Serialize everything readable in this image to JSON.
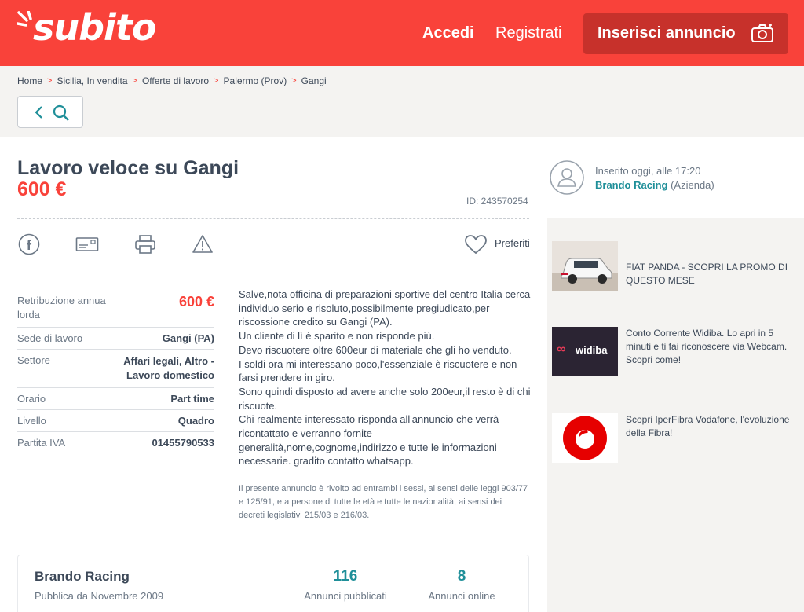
{
  "header": {
    "logo_text": "subito",
    "login": "Accedi",
    "register": "Registrati",
    "post_ad": "Inserisci annuncio",
    "brand_color": "#f9423a"
  },
  "breadcrumb": [
    "Home",
    "Sicilia, In vendita",
    "Offerte di lavoro",
    "Palermo (Prov)",
    "Gangi"
  ],
  "ad": {
    "title": "Lavoro veloce su Gangi",
    "price": "600 €",
    "id": "ID: 243570254",
    "favorites": "Preferiti",
    "details": [
      {
        "label": "Retribuzione annua lorda",
        "value": "600 €"
      },
      {
        "label": "Sede di lavoro",
        "value": "Gangi (PA)"
      },
      {
        "label": "Settore",
        "value": "Affari legali, Altro - Lavoro domestico"
      },
      {
        "label": "Orario",
        "value": "Part time"
      },
      {
        "label": "Livello",
        "value": "Quadro"
      },
      {
        "label": "Partita IVA",
        "value": "01455790533"
      }
    ],
    "description": "Salve,nota officina di preparazioni sportive del centro Italia cerca individuo serio e risoluto,possibilmente pregiudicato,per riscossione credito su Gangi (PA).\nUn cliente di lì è sparito e non risponde più.\nDevo riscuotere oltre 600eur di materiale che gli ho venduto.\nI soldi ora mi interessano poco,l'essenziale è riscuotere e non farsi prendere in giro.\nSono quindi disposto ad avere anche solo 200eur,il resto è di chi riscuote.\nChi realmente interessato risponda all'annuncio che verrà ricontattato e verranno fornite generalità,nome,cognome,indirizzo e tutte le informazioni necessarie. gradito contatto whatsapp.",
    "legal": "Il presente annuncio è rivolto ad entrambi i sessi, ai sensi delle leggi 903/77 e 125/91, e a persone di tutte le età e tutte le nazionalità, ai sensi dei decreti legislativi 215/03 e 216/03."
  },
  "seller": {
    "name": "Brando Racing",
    "since": "Pubblica da Novembre 2009",
    "published_count": "116",
    "published_label": "Annunci pubblicati",
    "online_count": "8",
    "online_label": "Annunci online",
    "posted_time": "Inserito oggi, alle 17:20",
    "posted_by_name": "Brando Racing",
    "posted_by_type": "(Azienda)"
  },
  "promos": [
    {
      "text": "FIAT PANDA - SCOPRI LA PROMO DI QUESTO MESE",
      "icon": "car-image"
    },
    {
      "text": "Conto Corrente Widiba. Lo apri in 5 minuti e ti fai riconoscere via Webcam. Scopri come!",
      "icon": "widiba-logo",
      "logo_text": "widiba"
    },
    {
      "text": "Scopri IperFibra Vodafone, l'evoluzione della Fibra!",
      "icon": "vodafone-logo"
    }
  ]
}
